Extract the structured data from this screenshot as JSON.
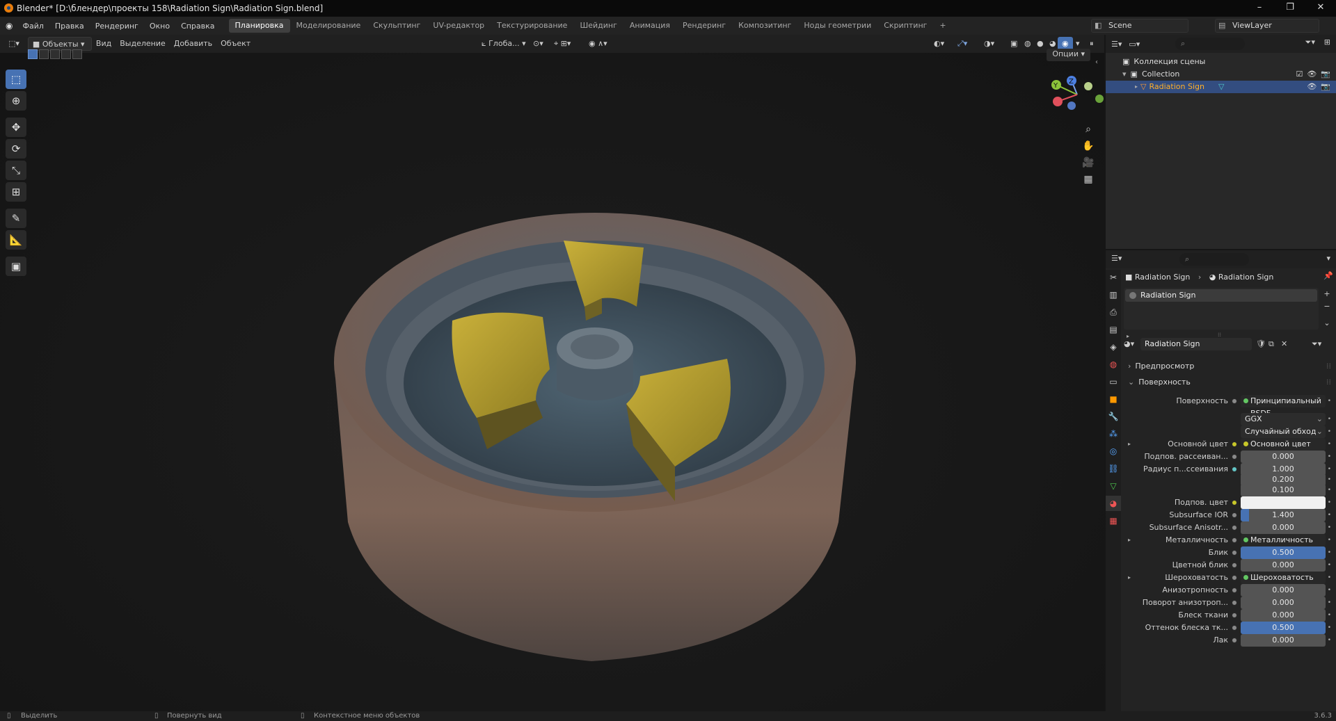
{
  "title_bar": {
    "title": "Blender* [D:\\блендер\\проекты 158\\Radiation Sign\\Radiation Sign.blend]",
    "minimize": "–",
    "maximize": "❐",
    "close": "✕"
  },
  "menu": {
    "items": [
      "Файл",
      "Правка",
      "Рендеринг",
      "Окно",
      "Справка"
    ]
  },
  "workspaces": [
    {
      "label": "Планировка",
      "active": true
    },
    {
      "label": "Моделирование"
    },
    {
      "label": "Скульптинг"
    },
    {
      "label": "UV-редактор"
    },
    {
      "label": "Текстурирование"
    },
    {
      "label": "Шейдинг"
    },
    {
      "label": "Анимация"
    },
    {
      "label": "Рендеринг"
    },
    {
      "label": "Композитинг"
    },
    {
      "label": "Ноды геометрии"
    },
    {
      "label": "Скриптинг"
    },
    {
      "label": "+"
    }
  ],
  "scene": {
    "name": "Scene",
    "view_layer": "ViewLayer"
  },
  "viewport_header": {
    "mode": "Объекты",
    "menus": [
      "Вид",
      "Выделение",
      "Добавить",
      "Объект"
    ],
    "orientation": "Глоба...",
    "options": "Опции"
  },
  "gizmo": {
    "x": "X",
    "y": "Y",
    "z": "Z"
  },
  "outliner": {
    "rows": [
      {
        "label": "Коллекция сцены"
      },
      {
        "label": "Collection"
      },
      {
        "label": "Radiation Sign",
        "selected": true
      }
    ]
  },
  "properties": {
    "breadcrumb": {
      "object": "Radiation Sign",
      "material": "Radiation Sign"
    },
    "slot": "Radiation Sign",
    "material_name": "Radiation Sign",
    "sections": {
      "preview": "Предпросмотр",
      "surface": "Поверхность"
    },
    "rows": [
      {
        "label": "Поверхность",
        "value": "Принципиальный BSDF",
        "kind": "link",
        "dot": "g"
      },
      {
        "label": "",
        "value": "GGX",
        "kind": "dark"
      },
      {
        "label": "",
        "value": "Случайный обход",
        "kind": "dark"
      },
      {
        "label": "Основной цвет",
        "value": "Основной цвет",
        "kind": "link",
        "dot": "y",
        "arrow": true
      },
      {
        "label": "Подпов. рассеиван...",
        "value": "0.000",
        "kind": "num",
        "dot": "g"
      },
      {
        "label": "Радиус п...ссеивания",
        "value": "1.000",
        "kind": "num",
        "dot": "b"
      },
      {
        "label": "",
        "value": "0.200",
        "kind": "num"
      },
      {
        "label": "",
        "value": "0.100",
        "kind": "num"
      },
      {
        "label": "Подпов. цвет",
        "value": "",
        "kind": "white",
        "dot": "y"
      },
      {
        "label": "Subsurface IOR",
        "value": "1.400",
        "kind": "num",
        "dot": "g",
        "fill": 0.1
      },
      {
        "label": "Subsurface Anisotr...",
        "value": "0.000",
        "kind": "num",
        "dot": "g"
      },
      {
        "label": "Металличность",
        "value": "Металличность",
        "kind": "link",
        "dot": "g",
        "arrow": true
      },
      {
        "label": "Блик",
        "value": "0.500",
        "kind": "num",
        "dot": "g",
        "fill": 1.0
      },
      {
        "label": "Цветной блик",
        "value": "0.000",
        "kind": "num",
        "dot": "g"
      },
      {
        "label": "Шероховатость",
        "value": "Шероховатость",
        "kind": "link",
        "dot": "g",
        "arrow": true
      },
      {
        "label": "Анизотропность",
        "value": "0.000",
        "kind": "num",
        "dot": "g"
      },
      {
        "label": "Поворот анизотроп...",
        "value": "0.000",
        "kind": "num",
        "dot": "g"
      },
      {
        "label": "Блеск ткани",
        "value": "0.000",
        "kind": "num",
        "dot": "g"
      },
      {
        "label": "Оттенок блеска тк...",
        "value": "0.500",
        "kind": "num",
        "dot": "g",
        "fill": 1.0
      },
      {
        "label": "Лак",
        "value": "0.000",
        "kind": "num",
        "dot": "g"
      }
    ]
  },
  "statusbar": {
    "select": "Выделить",
    "rotate": "Повернуть вид",
    "context": "Контекстное меню объектов",
    "version": "3.6.3"
  },
  "colors": {
    "accent": "#4772b3",
    "selected_text": "#ffaf29",
    "yellow_paint": "#b8a12a",
    "rust": "#7a5a48",
    "metal_blue": "#4a5c6c"
  }
}
